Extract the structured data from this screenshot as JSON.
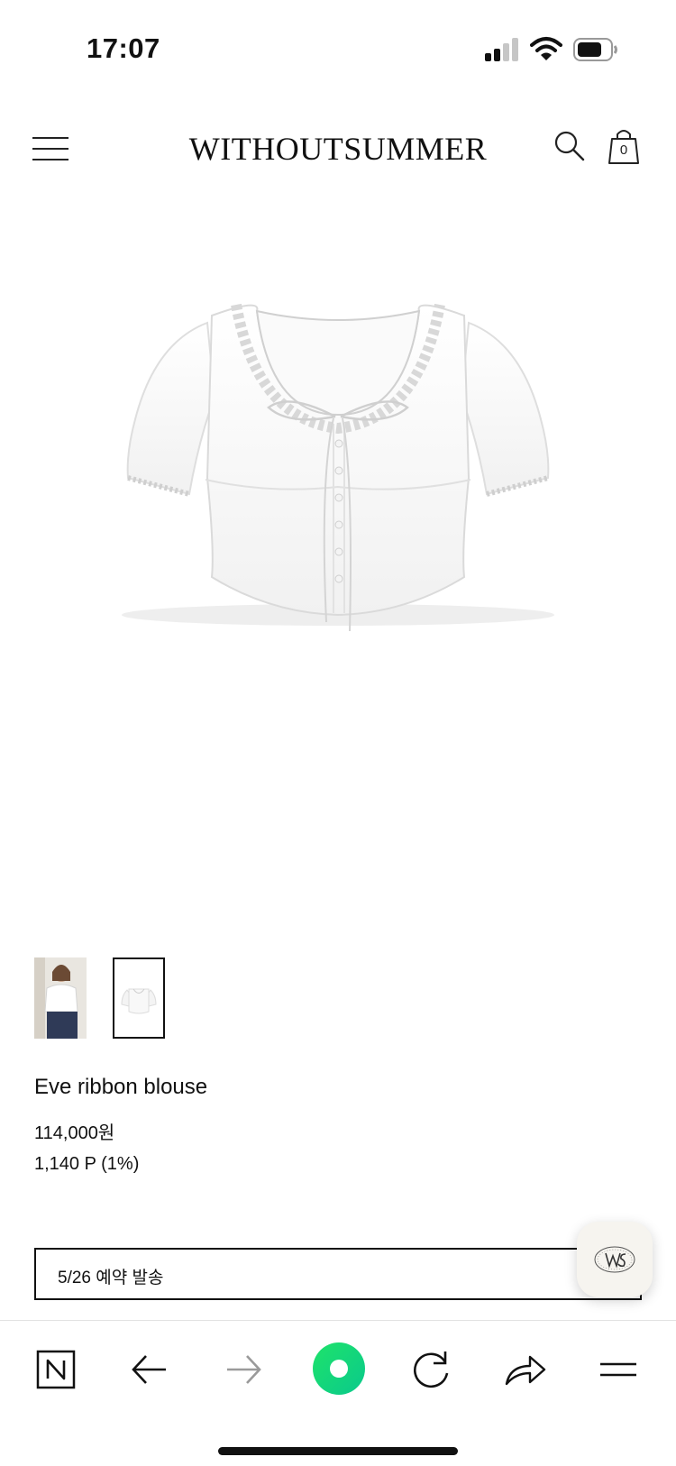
{
  "status_bar": {
    "time": "17:07",
    "signal_icon": "cellular-signal-icon",
    "wifi_icon": "wifi-icon",
    "battery_icon": "battery-icon"
  },
  "header": {
    "menu_icon": "hamburger-menu-icon",
    "brand": "WITHOUTSUMMER",
    "search_icon": "search-icon",
    "cart_icon": "shopping-bag-icon",
    "cart_count": "0"
  },
  "product": {
    "hero_image": "white-ribbon-blouse-photo",
    "thumbnails": [
      "model-wearing-blouse-thumbnail",
      "blouse-flat-thumbnail"
    ],
    "name": "Eve ribbon blouse",
    "price": "114,000원",
    "points": "1,140 P (1%)",
    "option": "5/26 예약 발송"
  },
  "floating_badge": {
    "icon": "ws-monogram-icon"
  },
  "browser_toolbar": {
    "items": [
      "naver-home-icon",
      "back-arrow-icon",
      "forward-arrow-icon",
      "green-dot-icon",
      "reload-icon",
      "share-icon",
      "menu-icon"
    ]
  },
  "colors": {
    "accent_green": "#14d879",
    "text": "#111111",
    "border": "#111111"
  }
}
